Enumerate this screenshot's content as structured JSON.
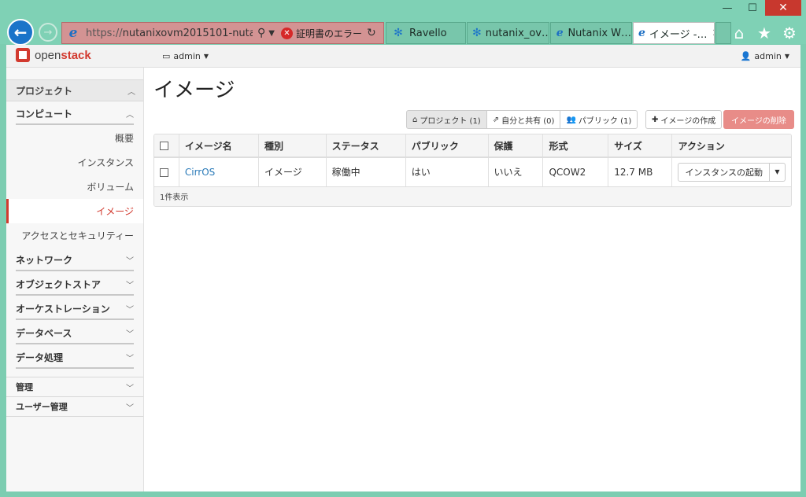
{
  "browser": {
    "url_host": "https://",
    "url_rest": "nutanixovm2015101-nutan…",
    "cert_error": "証明書のエラー",
    "tabs": [
      {
        "label": "Ravello"
      },
      {
        "label": "nutanix_ov…"
      },
      {
        "label": "Nutanix W…"
      },
      {
        "label": "イメージ -…"
      }
    ],
    "window_controls": {
      "minimize": "—",
      "maximize": "☐",
      "close": "✕"
    }
  },
  "topbar": {
    "logo_brand": "open",
    "logo_brand_bold": "stack",
    "project": "admin",
    "user": "admin"
  },
  "sidebar": {
    "project_header": "プロジェクト",
    "compute_header": "コンピュート",
    "compute_items": [
      {
        "label": "概要"
      },
      {
        "label": "インスタンス"
      },
      {
        "label": "ボリューム"
      },
      {
        "label": "イメージ"
      },
      {
        "label": "アクセスとセキュリティー"
      }
    ],
    "sections": [
      {
        "label": "ネットワーク"
      },
      {
        "label": "オブジェクトストア"
      },
      {
        "label": "オーケストレーション"
      },
      {
        "label": "データベース"
      },
      {
        "label": "データ処理"
      }
    ],
    "admin": "管理",
    "identity": "ユーザー管理"
  },
  "main": {
    "title": "イメージ",
    "filters": {
      "project": "プロジェクト (1)",
      "shared": "自分と共有 (0)",
      "public": "パブリック (1)"
    },
    "create_button": "イメージの作成",
    "delete_button": "イメージの削除",
    "columns": [
      "イメージ名",
      "種別",
      "ステータス",
      "パブリック",
      "保護",
      "形式",
      "サイズ",
      "アクション"
    ],
    "rows": [
      {
        "name": "CirrOS",
        "type": "イメージ",
        "status": "稼働中",
        "public": "はい",
        "protected": "いいえ",
        "format": "QCOW2",
        "size": "12.7 MB",
        "action": "インスタンスの起動"
      }
    ],
    "footer": "1件表示"
  },
  "colors": {
    "accent": "#d23a2f",
    "link": "#2a7ab8",
    "delete_btn": "#e88c88",
    "chrome": "#7fd1b5"
  }
}
